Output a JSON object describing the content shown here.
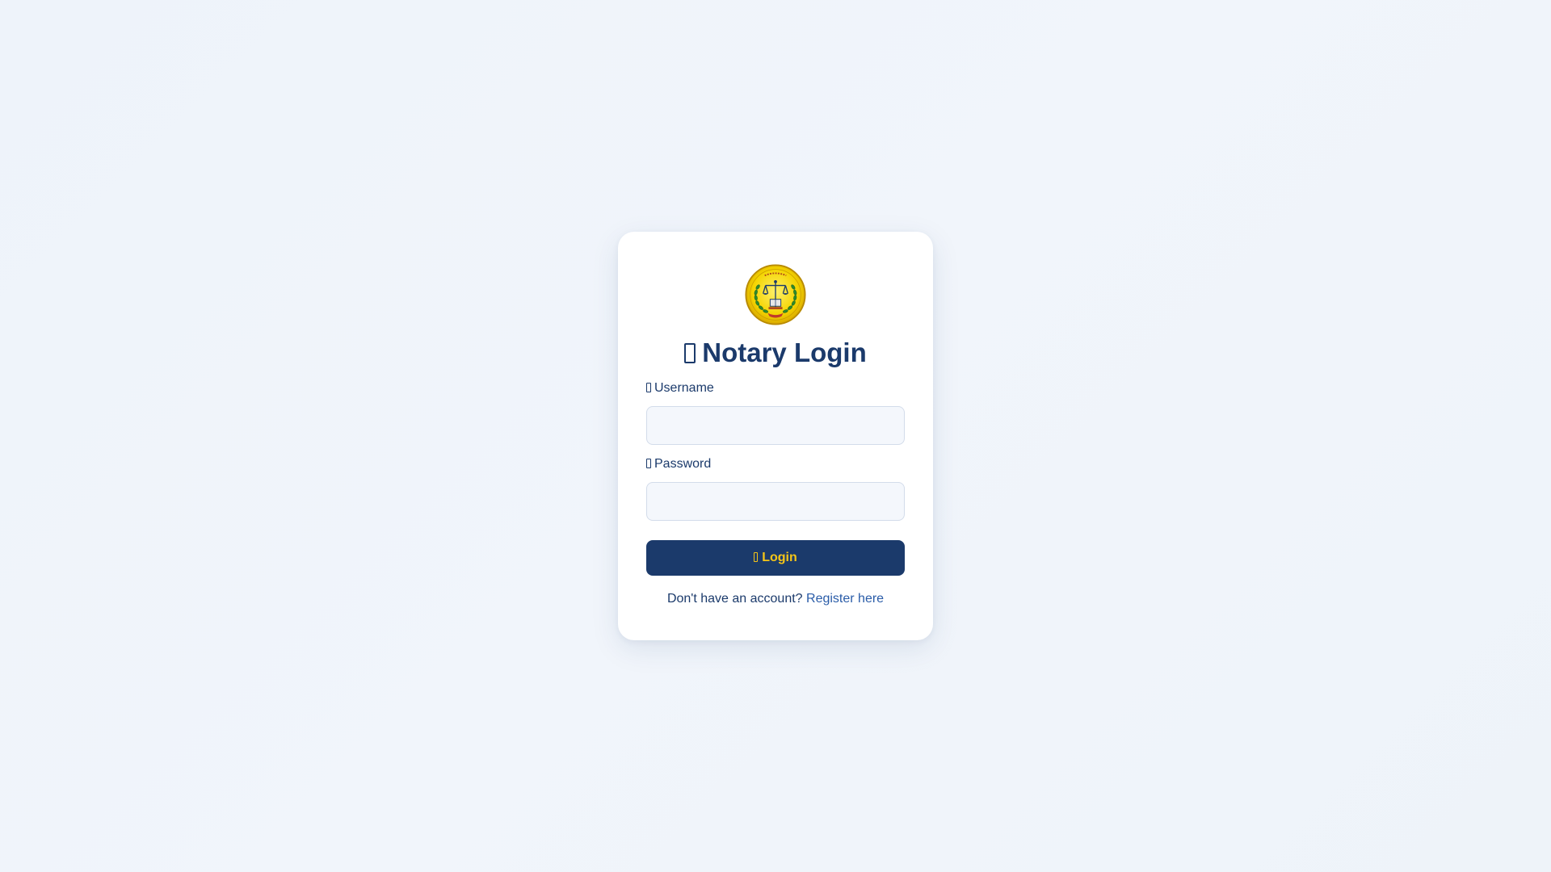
{
  "colors": {
    "primary": "#1b3a6b",
    "accent": "#f5c518",
    "link": "#2a5ca8",
    "input_bg": "#f4f7fc"
  },
  "login": {
    "logo_icon": "emblem-seal-icon",
    "title_icon": "user-shield-icon",
    "title": "Notary Login",
    "username": {
      "icon": "user-icon",
      "label": "Username",
      "value": "",
      "placeholder": ""
    },
    "password": {
      "icon": "lock-icon",
      "label": "Password",
      "value": "",
      "placeholder": ""
    },
    "button": {
      "icon": "sign-in-icon",
      "label": "Login"
    },
    "register_prompt": "Don't have an account?",
    "register_link": "Register here"
  }
}
